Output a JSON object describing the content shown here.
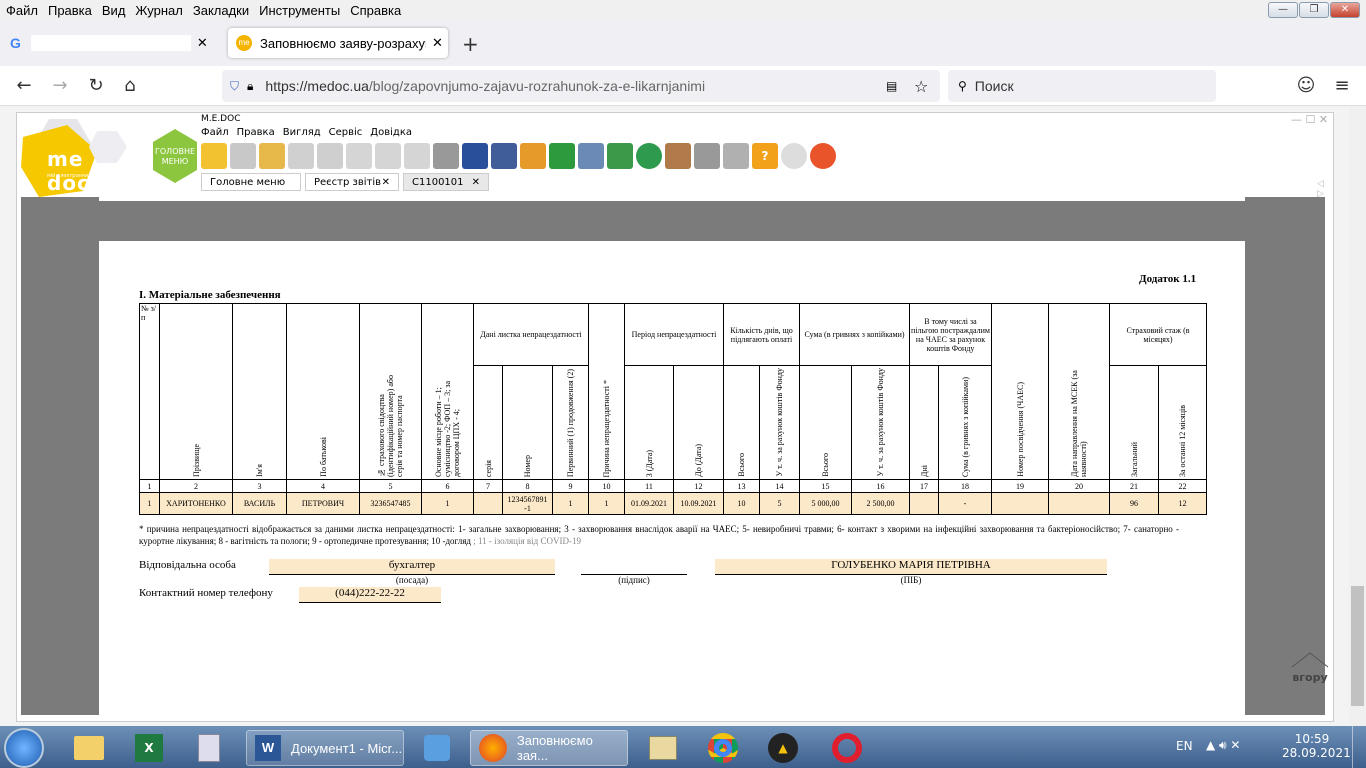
{
  "menubar": [
    "Файл",
    "Правка",
    "Вид",
    "Журнал",
    "Закладки",
    "Инструменты",
    "Справка"
  ],
  "tabs": {
    "active_title": "Заповнюємо заяву-розрахунок",
    "close": "✕",
    "new_tab": "+"
  },
  "nav": {
    "url_host": "https://medoc.ua",
    "url_path": "/blog/zapovnjumo-zajavu-rozrahunok-za-e-likarnjanimi",
    "search_placeholder": "Поиск"
  },
  "medoc": {
    "title": "M.E.DOC",
    "logo_text": "me doc",
    "logo_sub": "мій електронний документ",
    "mainmenu_icon_text": "ГОЛОВНЕ МЕНЮ",
    "menu": [
      "Файл",
      "Правка",
      "Вигляд",
      "Сервіс",
      "Довідка"
    ],
    "tabs": [
      {
        "label": "Головне меню"
      },
      {
        "label": "Реєстр звітів",
        "close": "✕"
      },
      {
        "label": "C1100101",
        "close": "✕"
      }
    ]
  },
  "doc": {
    "appendix": "Додаток 1.1",
    "section_title": "I. Матеріальне забезпечення",
    "headers": {
      "n": "№ з/п",
      "surname": "Прізвище",
      "name": "Ім'я",
      "patronymic": "По батькові",
      "insurance": "№ страхового свідоцтва (ідентифікаційний номер) або серія та номер паспорта",
      "workplace": "Основне місце роботи – 1; сумісництво -2; ФОП – 3; за договором ЦПХ - 4;",
      "sheet_group": "Дані листка непрацездатності",
      "series": "серія",
      "number": "Номер",
      "primary": "Первинний (1) продовження (2)",
      "cause": "Причина непрацездатності *",
      "period_group": "Період непрацездатності",
      "from": "З (Дата)",
      "to": "До (Дата)",
      "days_group": "Кількість днів, що підлягають оплаті",
      "days_total": "Всього",
      "days_fund": "У т. ч. за рахунок коштів Фонду",
      "sum_group": "Сума (в гривнях з копійками)",
      "sum_total": "Всього",
      "sum_fund": "У т. ч. за рахунок коштів Фонду",
      "chaes_group": "В тому числі за пільгою постраждалим на ЧАЕС за рахунок коштів Фонду",
      "chaes_days": "Дні",
      "chaes_sum": "Сума (в гривнях з копійками)",
      "chaes_cert": "Номер посвідчення (ЧАЕС)",
      "msek": "Дата направлення на МСЕК (за наявності)",
      "stage_group": "Страховий стаж (в місяцях)",
      "stage_total": "Загальний",
      "stage_12": "За останні 12 місяців"
    },
    "col_numbers": [
      "1",
      "2",
      "3",
      "4",
      "5",
      "6",
      "7",
      "8",
      "9",
      "10",
      "11",
      "12",
      "13",
      "14",
      "15",
      "16",
      "17",
      "18",
      "19",
      "20",
      "21",
      "22"
    ],
    "row": [
      "1",
      "ХАРИТОНЕНКО",
      "ВАСИЛЬ",
      "ПЕТРОВИЧ",
      "3236547485",
      "1",
      "",
      "1234567891 -1",
      "1",
      "1",
      "01.09.2021",
      "10.09.2021",
      "10",
      "5",
      "5 000,00",
      "2 500,00",
      "",
      "-",
      "",
      "",
      "96",
      "12"
    ],
    "footnote": "* причина непрацездатності відображається за даними листка непрацездатності: 1- загальне захворювання; 3 - захворювання внаслідок аварії на ЧАЕС; 5- невиробничі травми; 6- контакт з хворими на інфекційні захворювання та бактеріоносійство; 7- санаторно - курортне лікування; 8 - вагітність та пологи; 9 - ортопедичне протезування; 10 -догляд",
    "footnote_extra": "; 11 - ізоляція від COVID-19",
    "resp_label": "Відповідальна особа",
    "position_value": "бухгалтер",
    "position_caption": "(посада)",
    "sign_caption": "(підпис)",
    "pib_value": "ГОЛУБЕНКО МАРІЯ ПЕТРІВНА",
    "pib_caption": "(ПІБ)",
    "phone_label": "Контактний номер телефону",
    "phone_value": "(044)222-22-22"
  },
  "up_label": "вгору",
  "taskbar": {
    "item1": "Документ1 - Micr...",
    "item2": "Заповнюємо зая...",
    "lang": "EN",
    "time": "10:59",
    "date": "28.09.2021"
  }
}
